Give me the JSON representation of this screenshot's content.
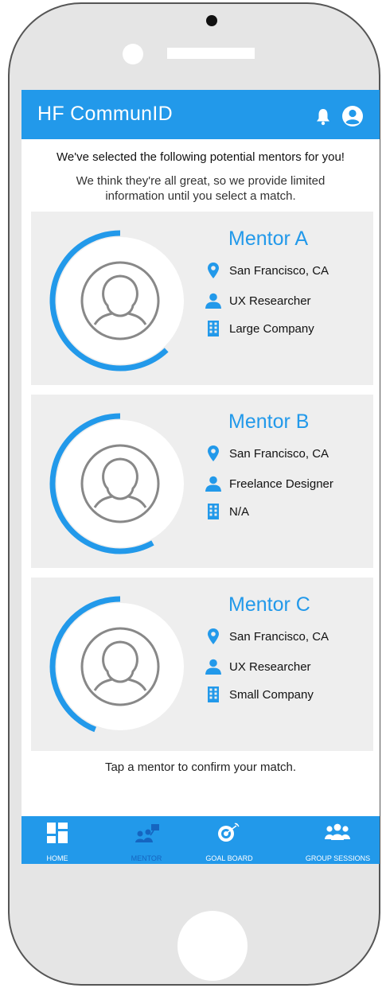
{
  "app": {
    "title": "HF CommunID"
  },
  "intro": {
    "heading": "We've selected the following potential mentors for you!",
    "subtext": "We think they're all great, so we provide limited information until you select a match."
  },
  "mentors": [
    {
      "name": "Mentor A",
      "location": "San Francisco, CA",
      "role": "UX Researcher",
      "company": "Large Company",
      "match_fraction": 0.62
    },
    {
      "name": "Mentor B",
      "location": "San Francisco, CA",
      "role": "Freelance Designer",
      "company": "N/A",
      "match_fraction": 0.58
    },
    {
      "name": "Mentor C",
      "location": "San Francisco, CA",
      "role": "UX Researcher",
      "company": "Small Company",
      "match_fraction": 0.44
    }
  ],
  "footer_note": "Tap a mentor to confirm your match.",
  "nav": {
    "items": [
      {
        "label": "HOME",
        "icon": "dashboard-icon",
        "active": false
      },
      {
        "label": "MENTOR",
        "icon": "mentor-icon",
        "active": true
      },
      {
        "label": "GOAL BOARD",
        "icon": "target-icon",
        "active": false
      },
      {
        "label": "GROUP SESSIONS",
        "icon": "group-icon",
        "active": false
      }
    ]
  },
  "colors": {
    "brand": "#2299ea",
    "active_nav": "#1565c0",
    "card_bg": "#eeeeee",
    "avatar_line": "#888888"
  }
}
